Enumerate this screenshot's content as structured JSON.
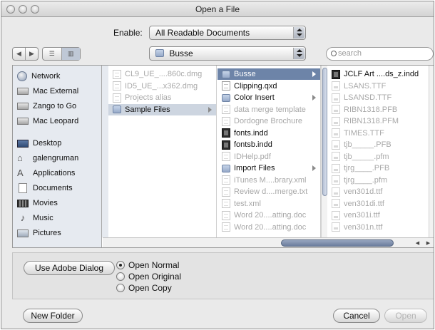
{
  "window": {
    "title": "Open a File"
  },
  "enable": {
    "label": "Enable:",
    "value": "All Readable Documents"
  },
  "location": {
    "value": "Busse"
  },
  "search": {
    "placeholder": "search"
  },
  "sidebar": {
    "items": [
      {
        "label": "Network",
        "icon": "network-icon"
      },
      {
        "label": "Mac External",
        "icon": "drive-icon"
      },
      {
        "label": "Zango to Go",
        "icon": "drive-icon"
      },
      {
        "label": "Mac Leopard",
        "icon": "drive-icon"
      },
      {
        "label": "Desktop",
        "icon": "desktop-icon"
      },
      {
        "label": "galengruman",
        "icon": "home-icon"
      },
      {
        "label": "Applications",
        "icon": "applications-icon"
      },
      {
        "label": "Documents",
        "icon": "documents-icon"
      },
      {
        "label": "Movies",
        "icon": "movies-icon"
      },
      {
        "label": "Music",
        "icon": "music-icon"
      },
      {
        "label": "Pictures",
        "icon": "pictures-icon"
      }
    ]
  },
  "columns": [
    {
      "items": [
        {
          "label": "CL9_UE_....860c.dmg",
          "kind": "doc",
          "dim": true
        },
        {
          "label": "ID5_UE_...x362.dmg",
          "kind": "doc",
          "dim": true
        },
        {
          "label": "Projects alias",
          "kind": "doc",
          "dim": true
        },
        {
          "label": "Sample Files",
          "kind": "folder",
          "state": "sel",
          "folder": true
        }
      ]
    },
    {
      "items": [
        {
          "label": "Busse",
          "kind": "folder",
          "state": "hl",
          "folder": true
        },
        {
          "label": "Clipping.qxd",
          "kind": "doc"
        },
        {
          "label": "Color Insert",
          "kind": "folder",
          "folder": true
        },
        {
          "label": "data merge template",
          "kind": "doc",
          "dim": true
        },
        {
          "label": "Dordogne Brochure",
          "kind": "doc",
          "dim": true
        },
        {
          "label": "fonts.indd",
          "kind": "indd"
        },
        {
          "label": "fontsb.indd",
          "kind": "indd"
        },
        {
          "label": "IDHelp.pdf",
          "kind": "doc",
          "dim": true
        },
        {
          "label": "Import Files",
          "kind": "folder",
          "folder": true
        },
        {
          "label": "iTunes M....brary.xml",
          "kind": "doc",
          "dim": true
        },
        {
          "label": "Review d....merge.txt",
          "kind": "doc",
          "dim": true
        },
        {
          "label": "test.xml",
          "kind": "doc",
          "dim": true
        },
        {
          "label": "Word 20....atting.doc",
          "kind": "doc",
          "dim": true
        },
        {
          "label": "Word 20....atting.doc",
          "kind": "doc",
          "dim": true
        }
      ]
    },
    {
      "items": [
        {
          "label": "JCLF Art ....ds_z.indd",
          "kind": "indd"
        },
        {
          "label": "LSANS.TTF",
          "kind": "font",
          "dim": true
        },
        {
          "label": "LSANSD.TTF",
          "kind": "font",
          "dim": true
        },
        {
          "label": "RIBN1318.PFB",
          "kind": "font",
          "dim": true
        },
        {
          "label": "RIBN1318.PFM",
          "kind": "font",
          "dim": true
        },
        {
          "label": "TIMES.TTF",
          "kind": "font",
          "dim": true
        },
        {
          "label": "tjb_____.PFB",
          "kind": "font",
          "dim": true
        },
        {
          "label": "tjb_____.pfm",
          "kind": "font",
          "dim": true
        },
        {
          "label": "tjrg____.PFB",
          "kind": "font",
          "dim": true
        },
        {
          "label": "tjrg____.pfm",
          "kind": "font",
          "dim": true
        },
        {
          "label": "ven301d.ttf",
          "kind": "font",
          "dim": true
        },
        {
          "label": "ven301di.ttf",
          "kind": "font",
          "dim": true
        },
        {
          "label": "ven301i.ttf",
          "kind": "font",
          "dim": true
        },
        {
          "label": "ven301n.ttf",
          "kind": "font",
          "dim": true
        }
      ]
    }
  ],
  "options": {
    "adobe_dialog_label": "Use Adobe Dialog",
    "radios": [
      {
        "label": "Open Normal",
        "checked": true
      },
      {
        "label": "Open Original",
        "checked": false
      },
      {
        "label": "Open Copy",
        "checked": false
      }
    ]
  },
  "footer": {
    "new_folder_label": "New Folder",
    "cancel_label": "Cancel",
    "open_label": "Open"
  }
}
